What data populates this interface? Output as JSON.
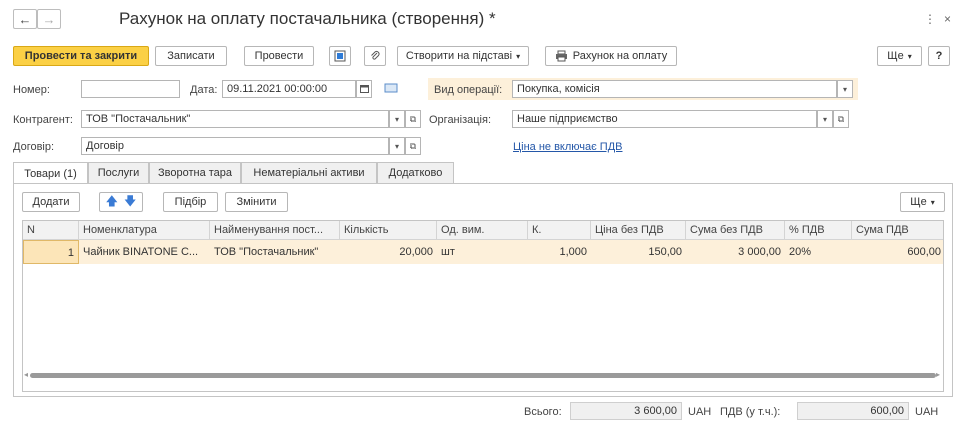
{
  "nav": {
    "back": "←",
    "forward": "→"
  },
  "window": {
    "title": "Рахунок на оплату постачальника (створення) *",
    "more_icon": "⋮",
    "close_icon": "×"
  },
  "toolbar": {
    "post_close": "Провести та закрити",
    "write": "Записати",
    "post": "Провести",
    "create_based": "Створити на підставі",
    "print_invoice": "Рахунок на оплату",
    "more": "Ще",
    "help": "?"
  },
  "form": {
    "number_label": "Номер:",
    "number_value": "",
    "date_label": "Дата:",
    "date_value": "09.11.2021 00:00:00",
    "operation_label": "Вид операції:",
    "operation_value": "Покупка, комісія",
    "counterparty_label": "Контрагент:",
    "counterparty_value": "ТОВ \"Постачальник\"",
    "organization_label": "Організація:",
    "organization_value": "Наше підприємство",
    "contract_label": "Договір:",
    "contract_value": "Договір",
    "vat_link": "Ціна не включає ПДВ"
  },
  "tabs": [
    "Товари (1)",
    "Послуги",
    "Зворотна тара",
    "Нематеріальні активи",
    "Додатково"
  ],
  "table_toolbar": {
    "add": "Додати",
    "selection": "Підбір",
    "change": "Змінити",
    "more": "Ще"
  },
  "table": {
    "columns": [
      "N",
      "Номенклатура",
      "Найменування пост...",
      "Кількість",
      "Од. вим.",
      "К.",
      "Ціна без ПДВ",
      "Сума без ПДВ",
      "% ПДВ",
      "Сума ПДВ"
    ],
    "rows": [
      [
        "1",
        "Чайник BINATONE C...",
        "ТОВ \"Постачальник\"",
        "20,000",
        "шт",
        "1,000",
        "150,00",
        "3 000,00",
        "20%",
        "600,00"
      ]
    ]
  },
  "footer": {
    "total_label": "Всього:",
    "total_value": "3 600,00",
    "currency1": "UAH",
    "vat_label": "ПДВ (у т.ч.):",
    "vat_value": "600,00",
    "currency2": "UAH"
  },
  "colors": {
    "primary": "#fbd045",
    "row_highlight": "#fdf0da",
    "link": "#2457a8"
  }
}
